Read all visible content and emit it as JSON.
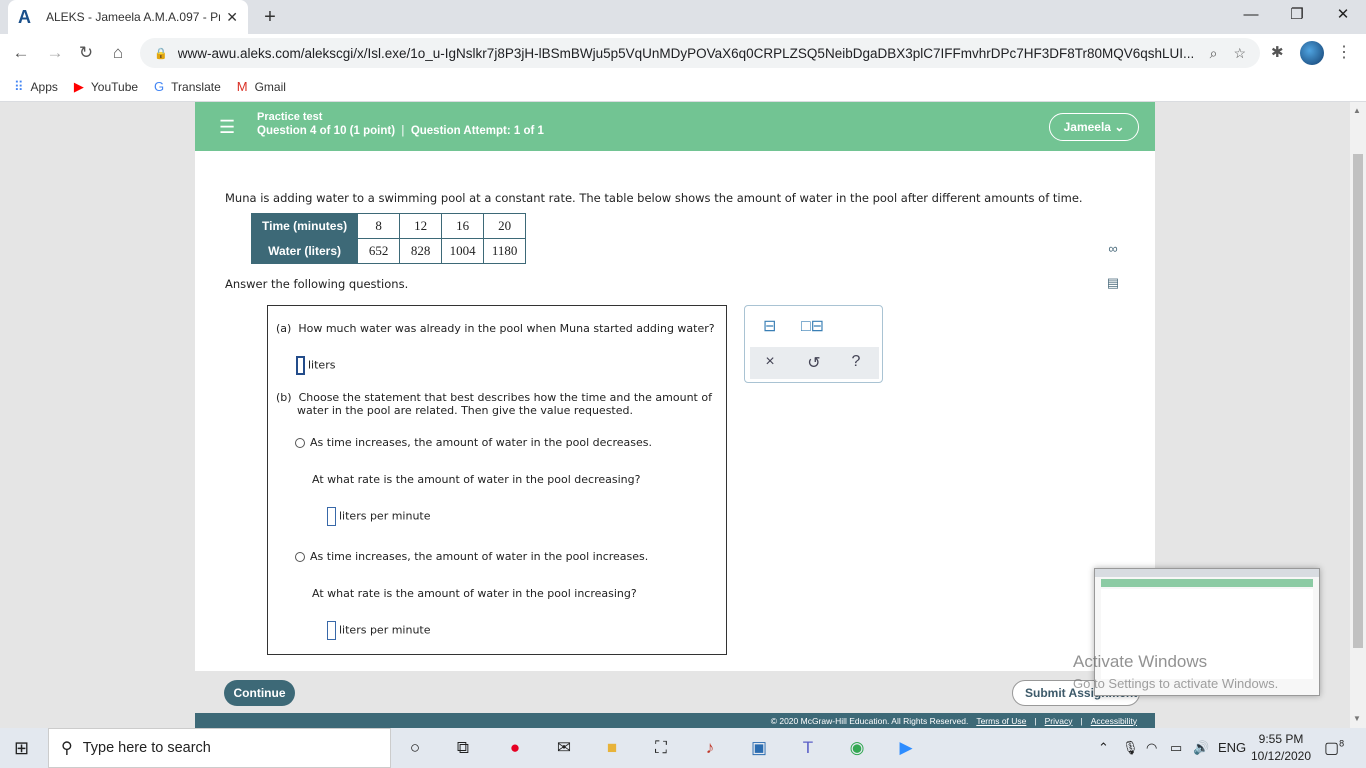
{
  "browser": {
    "tab_title": "ALEKS - Jameela A.M.A.097 - Pra",
    "tab_favicon": "A",
    "url": "www-awu.aleks.com/alekscgi/x/Isl.exe/1o_u-IgNslkr7j8P3jH-lBSmBWju5p5VqUnMDyPOVaX6q0CRPLZSQ5NeibDgaDBX3plC7IFFmvhrDPc7HF3DF8Tr80MQV6qshLUI...",
    "bookmarks": [
      {
        "label": "Apps",
        "icon": "apps-grid-icon"
      },
      {
        "label": "YouTube",
        "icon": "youtube-icon"
      },
      {
        "label": "Translate",
        "icon": "translate-icon"
      },
      {
        "label": "Gmail",
        "icon": "gmail-icon"
      }
    ]
  },
  "header": {
    "title": "Practice test",
    "question": "Question 4 of 10",
    "points": "(1 point)",
    "attempt": "Question Attempt: 1 of 1",
    "user": "Jameela"
  },
  "problem": {
    "prompt": "Muna is adding water to a swimming pool at a constant rate. The table below shows the amount of water in the pool after different amounts of time.",
    "table": {
      "row1_header": "Time (minutes)",
      "row1": [
        "8",
        "12",
        "16",
        "20"
      ],
      "row2_header": "Water (liters)",
      "row2": [
        "652",
        "828",
        "1004",
        "1180"
      ]
    },
    "instruction": "Answer the following questions."
  },
  "part_a": {
    "label": "(a)",
    "question": "How much water was already in the pool when Muna started adding water?",
    "unit": "liters"
  },
  "part_b": {
    "label": "(b)",
    "question_line1": "Choose the statement that best describes how the time and the amount of",
    "question_line2": "water in the pool are related. Then give the value requested.",
    "option1": "As time increases, the amount of water in the pool decreases.",
    "option1_q": "At what rate is the amount of water in the pool decreasing?",
    "option1_unit": "liters per minute",
    "option2": "As time increases, the amount of water in the pool increases.",
    "option2_q": "At what rate is the amount of water in the pool increasing?",
    "option2_unit": "liters per minute"
  },
  "toolpad": {
    "clear": "×",
    "undo": "↺",
    "help": "?"
  },
  "actions": {
    "continue": "Continue",
    "submit": "Submit Assignment"
  },
  "footer": {
    "copyright": "© 2020 McGraw-Hill Education. All Rights Reserved.",
    "terms": "Terms of Use",
    "privacy": "Privacy",
    "accessibility": "Accessibility"
  },
  "watermark": {
    "line1": "Activate Windows",
    "line2": "Go to Settings to activate Windows."
  },
  "taskbar": {
    "search_placeholder": "Type here to search",
    "language": "ENG",
    "time": "9:55 PM",
    "date": "10/12/2020",
    "notifications": "8"
  },
  "colors": {
    "header_green": "#72c493",
    "table_header": "#3d6977"
  }
}
